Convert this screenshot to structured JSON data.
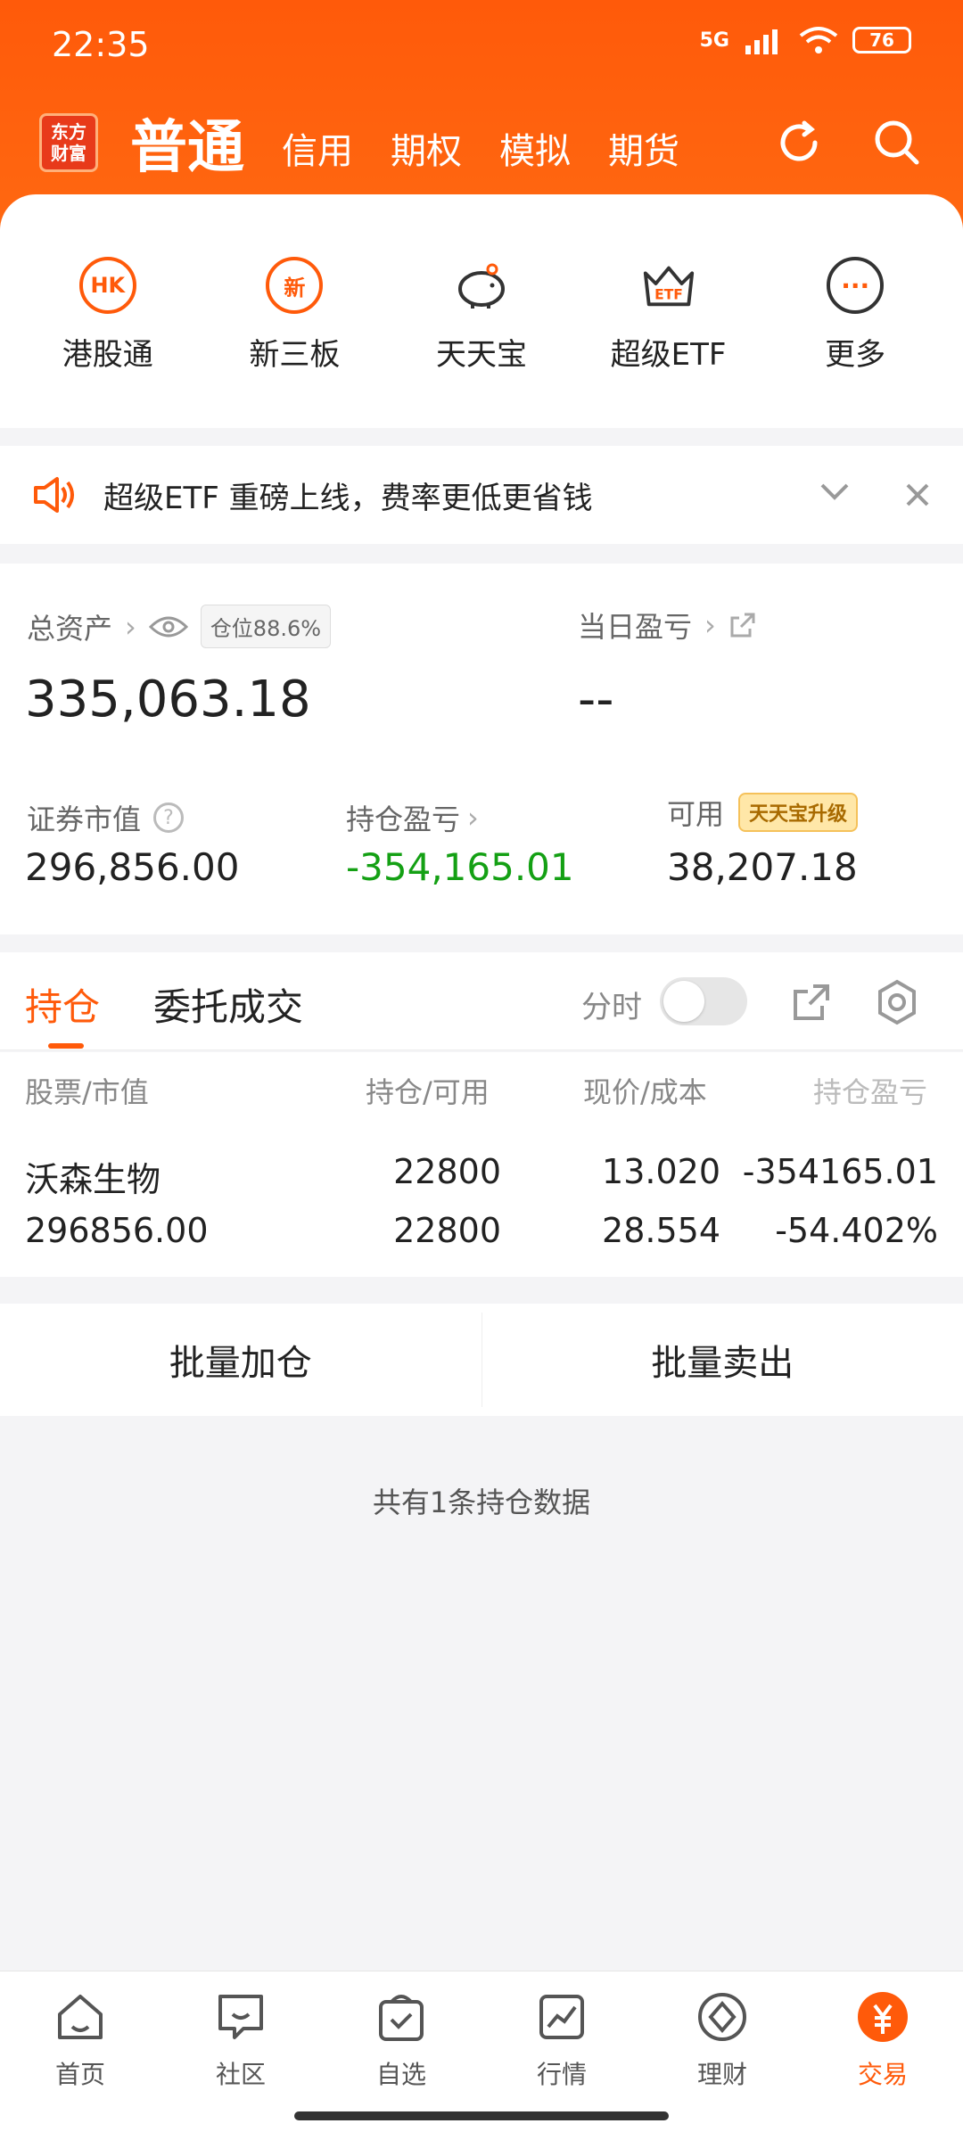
{
  "status": {
    "time": "22:35",
    "network": "5G",
    "battery": "76"
  },
  "header": {
    "logo_lines": [
      "东方",
      "财富"
    ],
    "mode_active": "普通",
    "modes": [
      "信用",
      "期权",
      "模拟",
      "期货"
    ],
    "icons": [
      "refresh-icon",
      "search-icon"
    ]
  },
  "quick": [
    {
      "label": "港股通",
      "icon_text": "HK",
      "icon": "hk-icon"
    },
    {
      "label": "新三板",
      "icon_text": "新",
      "icon": "new-board-icon"
    },
    {
      "label": "天天宝",
      "icon_text": "",
      "icon": "piggy-bank-icon"
    },
    {
      "label": "超级ETF",
      "icon_text": "ETF",
      "icon": "crown-etf-icon"
    },
    {
      "label": "更多",
      "icon_text": "···",
      "icon": "more-icon"
    }
  ],
  "notice": {
    "text": "超级ETF 重磅上线，费率更低更省钱"
  },
  "assets": {
    "total_label": "总资产",
    "position_chip": "仓位88.6%",
    "total_value": "335,063.18",
    "daily_label": "当日盈亏",
    "daily_value": "--",
    "market_label": "证券市值",
    "market_value": "296,856.00",
    "holding_pl_label": "持仓盈亏",
    "holding_pl_value": "-354,165.01",
    "available_label": "可用",
    "upgrade_badge": "天天宝升级",
    "available_value": "38,207.18",
    "accent_green": "#14a014"
  },
  "tabs": {
    "positions": "持仓",
    "orders": "委托成交",
    "timeshare": "分时"
  },
  "table": {
    "headers": [
      "股票/市值",
      "持仓/可用",
      "现价/成本",
      "持仓盈亏"
    ],
    "rows": [
      {
        "name": "沃森生物",
        "market_value": "296856.00",
        "position": "22800",
        "available": "22800",
        "price": "13.020",
        "cost": "28.554",
        "pl": "-354165.01",
        "pl_pct": "-54.402%"
      }
    ]
  },
  "actions": {
    "add": "批量加仓",
    "sell": "批量卖出"
  },
  "footer_count": "共有1条持仓数据",
  "tabbar": [
    "首页",
    "社区",
    "自选",
    "行情",
    "理财",
    "交易"
  ],
  "brand_color": "#ff5a0a"
}
